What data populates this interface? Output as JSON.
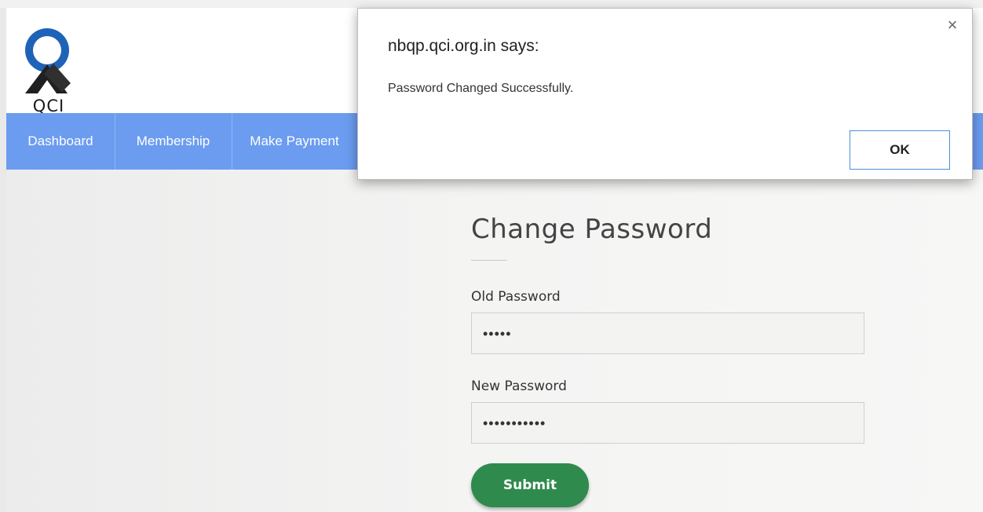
{
  "header": {
    "logo_text": "QCI"
  },
  "navbar": {
    "items": [
      {
        "label": "Dashboard"
      },
      {
        "label": "Membership"
      },
      {
        "label": "Make Payment"
      }
    ]
  },
  "form": {
    "title": "Change Password",
    "old_password_label": "Old Password",
    "old_password_value": "•••••",
    "new_password_label": "New Password",
    "new_password_value": "•••••••••••",
    "submit_label": "Submit"
  },
  "dialog": {
    "title": "nbqp.qci.org.in says:",
    "message": "Password Changed Successfully.",
    "ok_label": "OK",
    "close_icon": "close-icon"
  },
  "colors": {
    "nav_bg": "#6b9cf0",
    "submit_bg": "#2f8a4d",
    "ok_border": "#4a90d9"
  }
}
